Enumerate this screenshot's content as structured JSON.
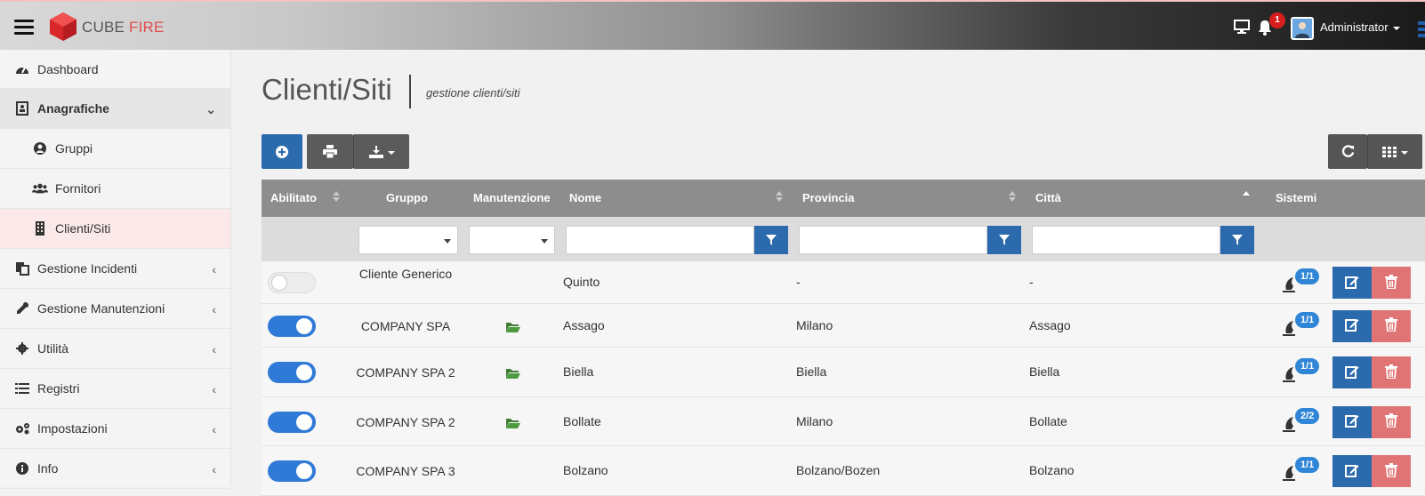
{
  "brand": {
    "name_part1": "CUBE",
    "name_part2": "FIRE"
  },
  "header": {
    "notifications_count": "1",
    "user_name": "Administrator"
  },
  "sidebar": {
    "items": [
      {
        "label": "Dashboard"
      },
      {
        "label": "Anagrafiche"
      },
      {
        "label": "Gruppi"
      },
      {
        "label": "Fornitori"
      },
      {
        "label": "Clienti/Siti"
      },
      {
        "label": "Gestione Incidenti"
      },
      {
        "label": "Gestione Manutenzioni"
      },
      {
        "label": "Utilità"
      },
      {
        "label": "Registri"
      },
      {
        "label": "Impostazioni"
      },
      {
        "label": "Info"
      }
    ]
  },
  "page": {
    "title": "Clienti/Siti",
    "subtitle": "gestione clienti/siti"
  },
  "table": {
    "columns": {
      "abilitato": "Abilitato",
      "gruppo": "Gruppo",
      "manutenzione": "Manutenzione",
      "nome": "Nome",
      "provincia": "Provincia",
      "citta": "Città",
      "sistemi": "Sistemi"
    },
    "rows": [
      {
        "enabled": false,
        "gruppo": "Cliente Generico",
        "manutenzione": false,
        "nome": "Quinto",
        "provincia": "-",
        "citta": "-",
        "sistemi": "1/1"
      },
      {
        "enabled": true,
        "gruppo": "COMPANY SPA",
        "manutenzione": true,
        "nome": "Assago",
        "provincia": "Milano",
        "citta": "Assago",
        "sistemi": "1/1"
      },
      {
        "enabled": true,
        "gruppo": "COMPANY SPA 2",
        "manutenzione": true,
        "nome": "Biella",
        "provincia": "Biella",
        "citta": "Biella",
        "sistemi": "1/1"
      },
      {
        "enabled": true,
        "gruppo": "COMPANY SPA 2",
        "manutenzione": true,
        "nome": "Bollate",
        "provincia": "Milano",
        "citta": "Bollate",
        "sistemi": "2/2"
      },
      {
        "enabled": true,
        "gruppo": "COMPANY SPA 3",
        "manutenzione": false,
        "nome": "Bolzano",
        "provincia": "Bolzano/Bozen",
        "citta": "Bolzano",
        "sistemi": "1/1"
      }
    ]
  },
  "colors": {
    "primary": "#2b6aad",
    "toggle_on": "#2f7ad6",
    "danger": "#e07373",
    "header_dark": "#1a1a1a",
    "brand_red": "#e34b4b"
  }
}
